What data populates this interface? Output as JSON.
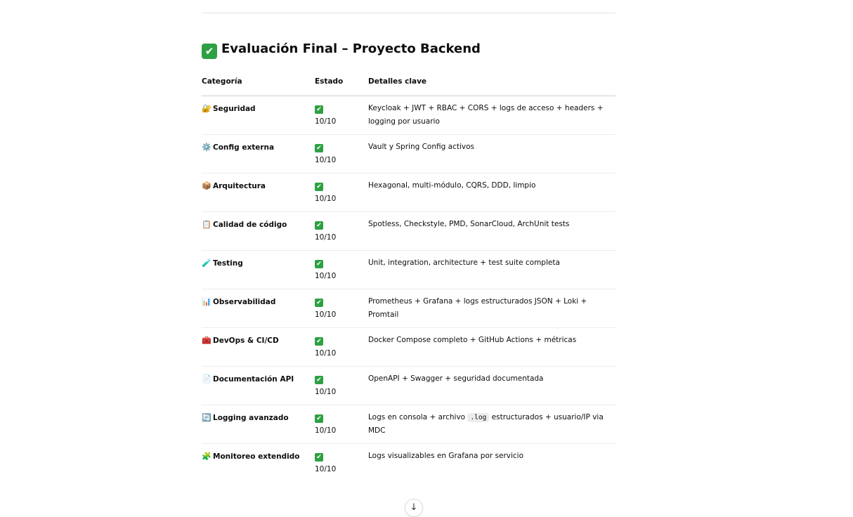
{
  "heading": {
    "icon": "check-mark-button-icon",
    "title": "Evaluación Final – Proyecto Backend"
  },
  "table": {
    "headers": [
      "Categoría",
      "Estado",
      "Detalles clave"
    ],
    "rows": [
      {
        "icon": "🔐",
        "category": "Seguridad",
        "status": "10/10",
        "details": "Keycloak + JWT + RBAC + CORS + logs de acceso + headers + logging por usuario"
      },
      {
        "icon": "⚙️",
        "category": "Config externa",
        "status": "10/10",
        "details": "Vault y Spring Config activos"
      },
      {
        "icon": "📦",
        "category": "Arquitectura",
        "status": "10/10",
        "details": "Hexagonal, multi-módulo, CQRS, DDD, limpio"
      },
      {
        "icon": "📋",
        "category": "Calidad de código",
        "status": "10/10",
        "details": "Spotless, Checkstyle, PMD, SonarCloud, ArchUnit tests"
      },
      {
        "icon": "🧪",
        "category": "Testing",
        "status": "10/10",
        "details": "Unit, integration, architecture + test suite completa"
      },
      {
        "icon": "📊",
        "category": "Observabilidad",
        "status": "10/10",
        "details": "Prometheus + Grafana + logs estructurados JSON + Loki + Promtail"
      },
      {
        "icon": "🧰",
        "category": "DevOps & CI/CD",
        "status": "10/10",
        "details": "Docker Compose completo + GitHub Actions + métricas"
      },
      {
        "icon": "📄",
        "category": "Documentación API",
        "status": "10/10",
        "details": "OpenAPI + Swagger + seguridad documentada"
      },
      {
        "icon": "🔄",
        "category": "Logging avanzado",
        "status": "10/10",
        "details_pre": "Logs en consola + archivo ",
        "details_code": ".log",
        "details_post": " estructurados + usuario/IP via MDC"
      },
      {
        "icon": "🧩",
        "category": "Monitoreo extendido",
        "status": "10/10",
        "details": "Logs visualizables en Grafana por servicio"
      }
    ]
  },
  "scroll_button": {
    "icon": "arrow-down-icon",
    "glyph": "↓"
  },
  "colors": {
    "check_green": "#2ea043",
    "text": "#0d0d0d",
    "divider": "#ececec"
  }
}
